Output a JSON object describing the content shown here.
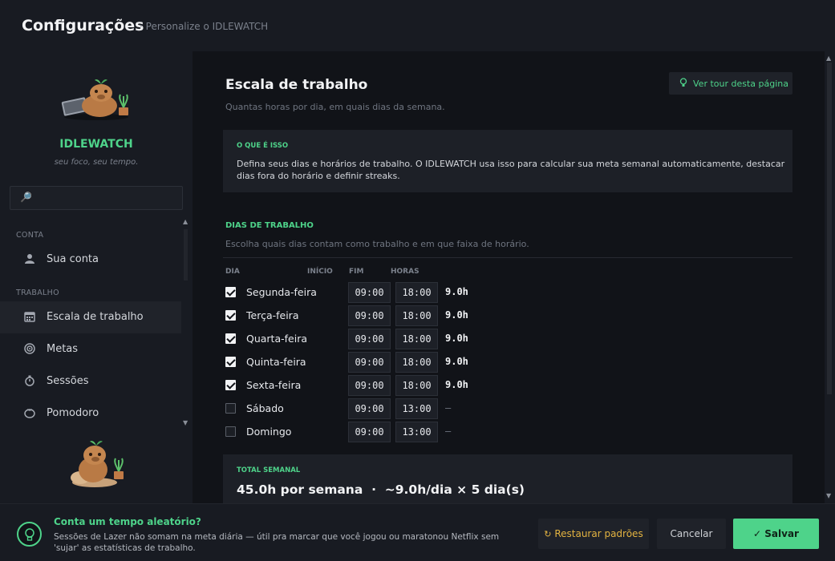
{
  "header": {
    "title": "Configurações",
    "subtitle": "· Personalize o IDLEWATCH"
  },
  "sidebar": {
    "brand": "IDLEWATCH",
    "tagline": "seu foco, seu tempo.",
    "search": {
      "value": "",
      "placeholder": ""
    },
    "sections": [
      {
        "label": "CONTA"
      },
      {
        "label": "TRABALHO"
      }
    ],
    "items": [
      {
        "label": "Sua conta",
        "icon": "user-icon",
        "active": false
      },
      {
        "label": "Escala de trabalho",
        "icon": "calendar-icon",
        "active": true
      },
      {
        "label": "Metas",
        "icon": "target-icon",
        "active": false
      },
      {
        "label": "Sessões",
        "icon": "stopwatch-icon",
        "active": false
      },
      {
        "label": "Pomodoro",
        "icon": "tomato-icon",
        "active": false
      }
    ]
  },
  "main": {
    "title": "Escala de trabalho",
    "subtitle": "Quantas horas por dia, em quais dias da semana.",
    "tour_label": "Ver tour desta página",
    "info": {
      "tag": "O QUE É ISSO",
      "text": "Defina seus dias e horários de trabalho. O IDLEWATCH usa isso para calcular sua meta semanal automaticamente, destacar dias fora do horário e definir streaks."
    },
    "days_section": {
      "title": "DIAS DE TRABALHO",
      "subtitle": "Escolha quais dias contam como trabalho e em que faixa de horário."
    },
    "columns": {
      "day": "DIA",
      "start": "INÍCIO",
      "end": "FIM",
      "hours": "HORAS"
    },
    "days": [
      {
        "name": "Segunda-feira",
        "checked": true,
        "start": "09:00",
        "end": "18:00",
        "hours": "9.0h"
      },
      {
        "name": "Terça-feira",
        "checked": true,
        "start": "09:00",
        "end": "18:00",
        "hours": "9.0h"
      },
      {
        "name": "Quarta-feira",
        "checked": true,
        "start": "09:00",
        "end": "18:00",
        "hours": "9.0h"
      },
      {
        "name": "Quinta-feira",
        "checked": true,
        "start": "09:00",
        "end": "18:00",
        "hours": "9.0h"
      },
      {
        "name": "Sexta-feira",
        "checked": true,
        "start": "09:00",
        "end": "18:00",
        "hours": "9.0h"
      },
      {
        "name": "Sábado",
        "checked": false,
        "start": "09:00",
        "end": "13:00",
        "hours": "—"
      },
      {
        "name": "Domingo",
        "checked": false,
        "start": "09:00",
        "end": "13:00",
        "hours": "—"
      }
    ],
    "total": {
      "tag": "TOTAL SEMANAL",
      "value": "45.0h por semana  ·  ~9.0h/dia × 5 dia(s)"
    }
  },
  "footer": {
    "tip_title": "Conta um tempo aleatório?",
    "tip_text": "Sessões de Lazer não somam na meta diária — útil pra marcar que você jogou ou maratonou Netflix sem 'sujar' as estatísticas de trabalho.",
    "restore_label": "Restaurar padrões",
    "cancel_label": "Cancelar",
    "save_label": "Salvar"
  },
  "colors": {
    "accent": "#4ed38a",
    "warning": "#e3b341",
    "background": "#181b22",
    "panel": "#111318"
  }
}
